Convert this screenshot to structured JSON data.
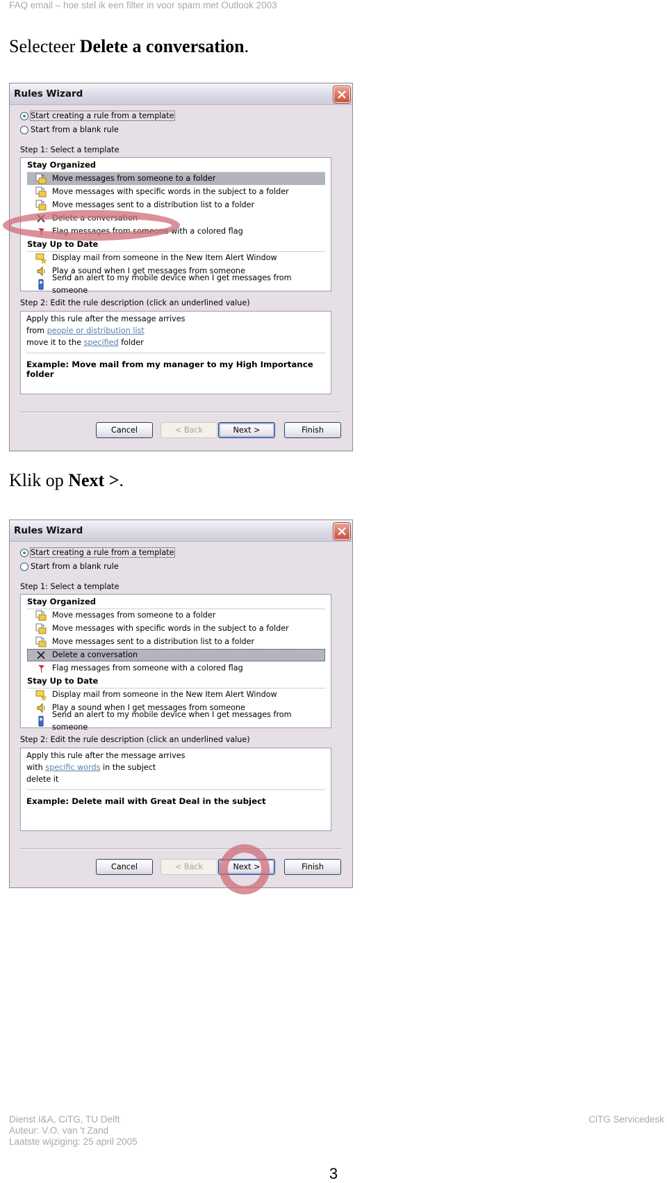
{
  "header": {
    "text": "FAQ email – hoe stel ik een filter in voor spam met Outlook 2003"
  },
  "captions": [
    {
      "prefix": "Selecteer ",
      "bold": "Delete a conversation",
      "suffix": "."
    },
    {
      "prefix": "Klik op ",
      "bold": "Next >",
      "suffix": "."
    }
  ],
  "dialogs": [
    {
      "title": "Rules Wizard",
      "radio_template": "Start creating a rule from a template",
      "radio_blank": "Start from a blank rule",
      "radio_selected": "template",
      "step1_label": "Step 1: Select a template",
      "groups": [
        {
          "name": "Stay Organized",
          "items": [
            {
              "icon": "folder-move-icon",
              "label": "Move messages from someone to a folder"
            },
            {
              "icon": "folder-move-icon",
              "label": "Move messages with specific words in the subject to a folder"
            },
            {
              "icon": "folder-move-icon",
              "label": "Move messages sent to a distribution list to a folder"
            },
            {
              "icon": "delete-x-icon",
              "label": "Delete a conversation"
            },
            {
              "icon": "flag-icon",
              "label": "Flag messages from someone with a colored flag"
            }
          ]
        },
        {
          "name": "Stay Up to Date",
          "items": [
            {
              "icon": "mail-alert-icon",
              "label": "Display mail from someone in the New Item Alert Window"
            },
            {
              "icon": "speaker-icon",
              "label": "Play a sound when I get messages from someone"
            },
            {
              "icon": "mobile-device-icon",
              "label": "Send an alert to my mobile device when I get messages from someone"
            }
          ]
        }
      ],
      "selected_item": "Move messages from someone to a folder",
      "highlight_annotation": "Delete a conversation",
      "step2_label": "Step 2: Edit the rule description (click an underlined value)",
      "description": {
        "line1": "Apply this rule after the message arrives",
        "line2_prefix": "from ",
        "line2_link": "people or distribution list",
        "line2_suffix": "",
        "line3_prefix": "move it to the ",
        "line3_link": "specified",
        "line3_suffix": " folder",
        "example": "Example: Move mail from my manager to my High Importance folder"
      },
      "buttons": {
        "cancel": "Cancel",
        "back": "< Back",
        "next": "Next >",
        "finish": "Finish"
      }
    },
    {
      "title": "Rules Wizard",
      "radio_template": "Start creating a rule from a template",
      "radio_blank": "Start from a blank rule",
      "radio_selected": "template",
      "step1_label": "Step 1: Select a template",
      "groups": [
        {
          "name": "Stay Organized",
          "items": [
            {
              "icon": "folder-move-icon",
              "label": "Move messages from someone to a folder"
            },
            {
              "icon": "folder-move-icon",
              "label": "Move messages with specific words in the subject to a folder"
            },
            {
              "icon": "folder-move-icon",
              "label": "Move messages sent to a distribution list to a folder"
            },
            {
              "icon": "delete-x-icon",
              "label": "Delete a conversation"
            },
            {
              "icon": "flag-icon",
              "label": "Flag messages from someone with a colored flag"
            }
          ]
        },
        {
          "name": "Stay Up to Date",
          "items": [
            {
              "icon": "mail-alert-icon",
              "label": "Display mail from someone in the New Item Alert Window"
            },
            {
              "icon": "speaker-icon",
              "label": "Play a sound when I get messages from someone"
            },
            {
              "icon": "mobile-device-icon",
              "label": "Send an alert to my mobile device when I get messages from someone"
            }
          ]
        }
      ],
      "selected_item": "Delete a conversation",
      "highlight_annotation": "Next >",
      "step2_label": "Step 2: Edit the rule description (click an underlined value)",
      "description": {
        "line1": "Apply this rule after the message arrives",
        "line2_prefix": "with ",
        "line2_link": "specific words",
        "line2_suffix": " in the subject",
        "line3_prefix": "delete it",
        "line3_link": "",
        "line3_suffix": "",
        "example": "Example: Delete mail with Great Deal in the subject"
      },
      "buttons": {
        "cancel": "Cancel",
        "back": "< Back",
        "next": "Next >",
        "finish": "Finish"
      }
    }
  ],
  "footer": {
    "left": [
      "Dienst I&A, CiTG, TU Delft",
      "Auteur: V.O. van 't Zand",
      "Laatste wijziging: 25 april 2005"
    ],
    "right": "CiTG Servicedesk",
    "page_number": "3"
  },
  "colors": {
    "annotation": "#ce6c78",
    "link": "#5a7fb0",
    "selection": "#b4b4bc",
    "dialog_bg": "#e6dfe6"
  }
}
